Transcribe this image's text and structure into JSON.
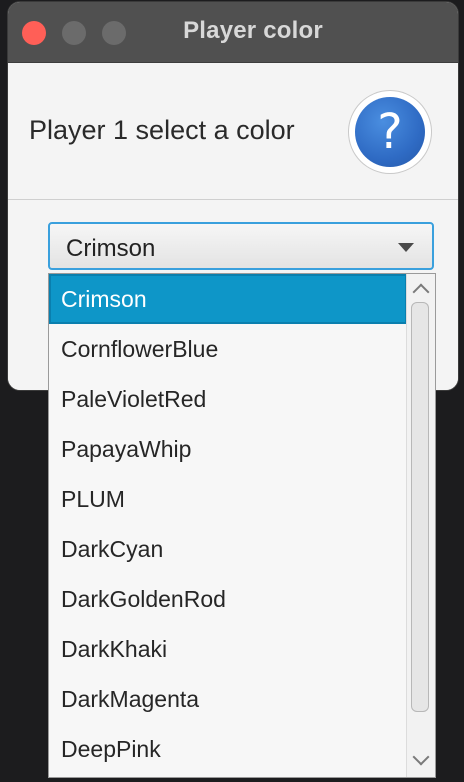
{
  "window": {
    "title": "Player color"
  },
  "dialog": {
    "header_text": "Player 1 select a color",
    "help_icon_glyph": "?"
  },
  "combo": {
    "selected_value": "Crimson"
  },
  "dropdown": {
    "items": [
      "Crimson",
      "CornflowerBlue",
      "PaleVioletRed",
      "PapayaWhip",
      "PLUM",
      "DarkCyan",
      "DarkGoldenRod",
      "DarkKhaki",
      "DarkMagenta",
      "DeepPink"
    ],
    "selected_index": 0
  },
  "colors": {
    "titlebar": "#505050",
    "close_button": "#ff5f57",
    "selection": "#0e96c8",
    "focus_border": "#3aa0dd",
    "help_icon": "#2f6bc4"
  }
}
